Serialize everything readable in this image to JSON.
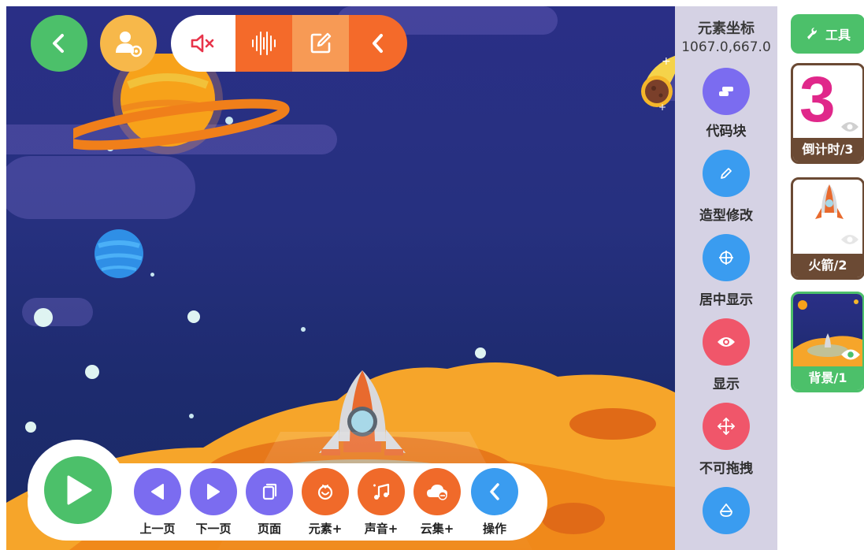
{
  "top_controls": {
    "back_icon": "chevron-left-icon",
    "user_settings_icon": "user-gear-icon",
    "mute_icon": "speaker-mute-icon",
    "waveform_icon": "waveform-icon",
    "edit_icon": "edit-square-icon",
    "collapse_icon": "chevron-left-icon"
  },
  "element_panel": {
    "coord_title": "元素坐标",
    "coord_value": "1067.0,667.0",
    "actions": [
      {
        "label": "代码块",
        "icon": "code-block-icon",
        "color": "#7b6cf0"
      },
      {
        "label": "造型修改",
        "icon": "pencil-icon",
        "color": "#3a9cf0"
      },
      {
        "label": "居中显示",
        "icon": "crosshair-icon",
        "color": "#3a9cf0"
      },
      {
        "label": "显示",
        "icon": "eye-icon",
        "color": "#f0566a"
      },
      {
        "label": "不可拖拽",
        "icon": "move-arrows-icon",
        "color": "#f0566a"
      },
      {
        "label": "",
        "icon": "layer-icon",
        "color": "#3a9cf0"
      }
    ]
  },
  "sidebar": {
    "tool_label": "工具",
    "sprites": [
      {
        "label": "倒计时/3",
        "number": "3",
        "active": false
      },
      {
        "label": "火箭/2",
        "active": false
      },
      {
        "label": "背景/1",
        "active": true
      }
    ]
  },
  "bottom_bar": {
    "play_icon": "play-icon",
    "buttons": [
      {
        "label": "上一页",
        "icon": "prev-triangle-icon",
        "color": "#7b6cf0"
      },
      {
        "label": "下一页",
        "icon": "next-triangle-icon",
        "color": "#7b6cf0"
      },
      {
        "label": "页面",
        "icon": "pages-icon",
        "color": "#7b6cf0"
      },
      {
        "label": "元素+",
        "icon": "element-add-icon",
        "color": "#f06a2a"
      },
      {
        "label": "声音+",
        "icon": "music-add-icon",
        "color": "#f06a2a"
      },
      {
        "label": "云集+",
        "icon": "cloud-add-icon",
        "color": "#f06a2a"
      },
      {
        "label": "操作",
        "icon": "chevron-left-icon",
        "color": "#3a9cf0"
      }
    ]
  }
}
